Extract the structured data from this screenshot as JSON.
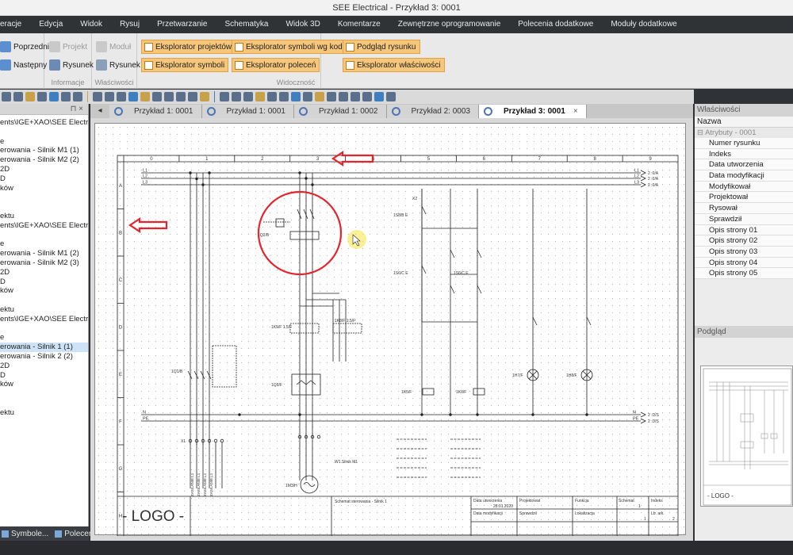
{
  "window": {
    "title": "SEE Electrical - Przykład 3: 0001"
  },
  "menu": [
    "eracje",
    "Edycja",
    "Widok",
    "Rysuj",
    "Przetwarzanie",
    "Schematyka",
    "Widok 3D",
    "Komentarze",
    "Zewnętrzne oprogramowanie",
    "Polecenia dodatkowe",
    "Moduły dodatkowe"
  ],
  "ribbon": {
    "nav": {
      "prev": "Poprzedni",
      "next": "Następny"
    },
    "info": {
      "project": "Projekt",
      "drawing": "Rysunek",
      "label": "Informacje"
    },
    "props": {
      "module": "Moduł",
      "drawing": "Rysunek",
      "label": "Właściwości"
    },
    "visibility": {
      "label": "Widoczność",
      "buttons": [
        "Eksplorator projektów",
        "Eksplorator symboli wg kodu",
        "Podgląd rysunku",
        "Eksplorator symboli",
        "Eksplorator poleceń",
        "Eksplorator właściwości"
      ]
    }
  },
  "left_panel": {
    "pin": "⊓ ×",
    "tree": [
      "ents\\IGE+XAO\\SEE Electrical\\",
      "",
      "e",
      "erowania - Silnik M1 (1)",
      "erowania - Silnik M2 (2)",
      "2D",
      "D",
      "ków",
      "",
      "",
      "ektu",
      "ents\\IGE+XAO\\SEE Electrical\\",
      "",
      "e",
      "erowania - Silnik M1 (2)",
      "erowania - Silnik M2 (3)",
      "2D",
      "D",
      "ków",
      "",
      "ektu",
      "ents\\IGE+XAO\\SEE Electrical\\",
      "",
      "e",
      "erowania - Silnik 1 (1)",
      "erowania - Silnik 2 (2)",
      "2D",
      "D",
      "ków",
      "",
      "",
      "ektu"
    ],
    "selected_index": 24,
    "tabs": [
      "Symbole...",
      "Polecenia"
    ]
  },
  "doc_tabs": {
    "tabs": [
      "Przykład 1: 0001",
      "Przykład 1: 0001",
      "Przykład 1: 0002",
      "Przykład 2: 0003",
      "Przykład 3: 0001"
    ],
    "active_index": 4,
    "close_glyph": "×"
  },
  "schematic": {
    "columns": [
      "0",
      "1",
      "2",
      "3",
      "4",
      "5",
      "6",
      "7",
      "8",
      "9"
    ],
    "rows": [
      "A",
      "B",
      "C",
      "D",
      "E",
      "F",
      "G",
      "H"
    ],
    "rails_left": [
      "L1",
      "L2",
      "L3"
    ],
    "rails_right": [
      "L1",
      "L2",
      "L3"
    ],
    "rail_refs": [
      "2 :0/A",
      "2 :0/A",
      "2 :0/A"
    ],
    "neutral_left": [
      "N",
      "PE"
    ],
    "neutral_right": [
      "N",
      "PE"
    ],
    "neutral_refs": [
      "2 :D/S",
      "2 :D/S"
    ],
    "labels": {
      "q1": "1Q1/B",
      "q2": "1Q2/B",
      "q3": "1Q3/F",
      "k1": "1K5/F\n1.5/F",
      "k2": "1K6/F\n1.5/F",
      "km1": "1K5/F",
      "km2": "1K6/F",
      "s1": "1S8/B E",
      "s2": "1S6/C E",
      "s3": "1S6/C E",
      "h1": "1H7/F",
      "h2": "1H8/F",
      "motor": "1M3/H",
      "motor_text": "W1\nSilnik M1",
      "x1": "X1",
      "x2": "X2",
      "cable": "ZASILANIE L1"
    },
    "title_block": {
      "logo": "- LOGO -",
      "description": "Schemat sterowania - Silnik 1",
      "created_label": "Data utworzenia",
      "created_value": "28.01.2020",
      "modified_label": "Data modyfikacji",
      "project_label": "Projektował",
      "checked_label": "Sprawdził",
      "function_label": "Funkcja",
      "location_label": "Lokalizacja",
      "sheet_label": "Schemat",
      "sheet_value": "1",
      "index_label": "Indeks",
      "count_label": "Lb. ark.",
      "count_value": "2",
      "page_value": "1",
      "page_total": "2"
    }
  },
  "right_panel": {
    "title": "Właściwości",
    "column": "Nazwa",
    "group": "Atrybuty - 0001",
    "properties": [
      "Numer rysunku",
      "Indeks",
      "Data utworzenia",
      "Data modyfikacji",
      "Modyfikował",
      "Projektował",
      "Rysował",
      "Sprawdził",
      "Opis strony 01",
      "Opis strony 02",
      "Opis strony 03",
      "Opis strony 04",
      "Opis strony 05"
    ],
    "preview_title": "Podgląd",
    "preview_logo": "- LOGO -"
  },
  "colors": {
    "annotation_red": "#e8222b",
    "tab_orange": "#f6c77b",
    "highlight_yellow": "#f5e642"
  }
}
